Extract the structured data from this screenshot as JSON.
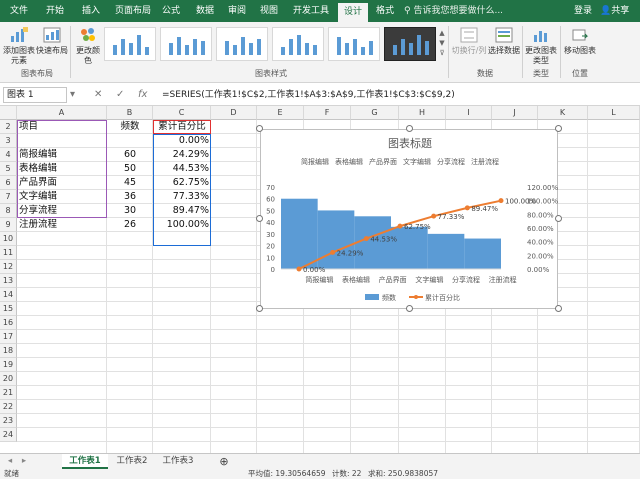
{
  "ribbon_tabs": [
    "文件",
    "开始",
    "插入",
    "页面布局",
    "公式",
    "数据",
    "审阅",
    "视图",
    "开发工具",
    "设计",
    "格式"
  ],
  "active_tab": "设计",
  "tell_me": "告诉我您想要做什么...",
  "login": "登录",
  "share": "共享",
  "ribbon": {
    "add_element": "添加图表元素",
    "quick_layout": "快速布局",
    "change_colors": "更改颜色",
    "switch_row_col": "切换行/列",
    "select_data": "选择数据",
    "change_type": "更改图表类型",
    "move_chart": "移动图表",
    "group_layout": "图表布局",
    "group_styles": "图表样式",
    "group_data": "数据",
    "group_type": "类型",
    "group_location": "位置"
  },
  "formula_bar": {
    "name_box": "图表 1",
    "cancel": "✕",
    "enter": "✓",
    "fx": "fx",
    "formula": "=SERIES(工作表1!$C$2,工作表1!$A$3:$A$9,工作表1!$C$3:$C$9,2)"
  },
  "columns": [
    "A",
    "B",
    "C",
    "D",
    "E",
    "F",
    "G",
    "H",
    "I",
    "J",
    "K",
    "L"
  ],
  "rows": [
    "2",
    "3",
    "4",
    "5",
    "6",
    "7",
    "8",
    "9",
    "10",
    "11",
    "12",
    "13",
    "14",
    "15",
    "16",
    "17",
    "18",
    "19",
    "20",
    "21",
    "22",
    "23",
    "24"
  ],
  "table": {
    "headers": [
      "项目",
      "频数",
      "累计百分比"
    ],
    "row3": [
      "",
      "",
      "0.00%"
    ],
    "data": [
      [
        "简报编辑",
        "60",
        "24.29%"
      ],
      [
        "表格编辑",
        "50",
        "44.53%"
      ],
      [
        "产品界面",
        "45",
        "62.75%"
      ],
      [
        "文字编辑",
        "36",
        "77.33%"
      ],
      [
        "分享流程",
        "30",
        "89.47%"
      ],
      [
        "注册流程",
        "26",
        "100.00%"
      ]
    ]
  },
  "chart_data": {
    "type": "bar",
    "title": "图表标题",
    "categories": [
      "简报编辑",
      "表格编辑",
      "产品界面",
      "文字编辑",
      "分享流程",
      "注册流程"
    ],
    "series": [
      {
        "name": "频数",
        "type": "bar",
        "axis": "left",
        "values": [
          60,
          50,
          45,
          36,
          30,
          26
        ],
        "color": "#5b9bd5"
      },
      {
        "name": "累计百分比",
        "type": "line",
        "axis": "right",
        "x": [
          0,
          1,
          2,
          3,
          4,
          5,
          6
        ],
        "values": [
          0,
          24.29,
          44.53,
          62.75,
          77.33,
          89.47,
          100
        ],
        "labels": [
          "0.00%",
          "24.29%",
          "44.53%",
          "62.75%",
          "77.33%",
          "89.47%",
          "100.00%"
        ],
        "color": "#ed7d31"
      }
    ],
    "y_left": {
      "ticks": [
        "0",
        "10",
        "20",
        "30",
        "40",
        "50",
        "60",
        "70"
      ],
      "range": [
        0,
        70
      ]
    },
    "y_right": {
      "ticks": [
        "0.00%",
        "20.00%",
        "40.00%",
        "60.00%",
        "80.00%",
        "100.00%",
        "120.00%"
      ],
      "range": [
        0,
        120
      ]
    },
    "secondary_x_labels": [
      "简报编辑",
      "表格编辑",
      "产品界面",
      "文字编辑",
      "分享流程",
      "注册流程"
    ],
    "legend": [
      "频数",
      "累计百分比"
    ],
    "legend_position": "bottom",
    "grid": false
  },
  "sheets": [
    "工作表1",
    "工作表2",
    "工作表3"
  ],
  "active_sheet": "工作表1",
  "add_sheet": "⊕",
  "status": {
    "ready": "就绪",
    "average": "平均值: 19.30564659",
    "count": "计数: 22",
    "sum": "求和: 250.9838057"
  }
}
